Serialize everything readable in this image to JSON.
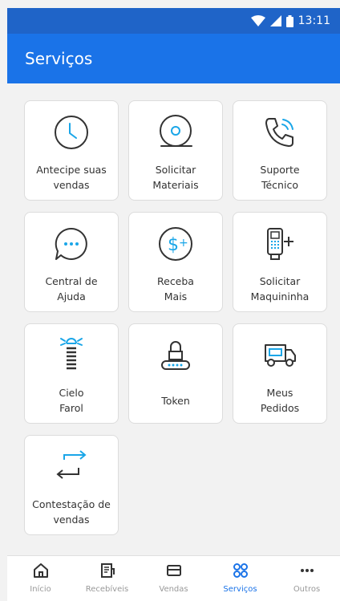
{
  "status_bar": {
    "time": "13:11",
    "icons": [
      "wifi-icon",
      "signal-icon",
      "battery-icon"
    ]
  },
  "app_bar": {
    "title": "Serviços"
  },
  "services": [
    {
      "label": "Antecipe suas\nvendas",
      "icon": "clock-icon"
    },
    {
      "label": "Solicitar\nMateriais",
      "icon": "paper-roll-icon"
    },
    {
      "label": "Suporte\nTécnico",
      "icon": "phone-ringing-icon"
    },
    {
      "label": "Central de\nAjuda",
      "icon": "chat-bubble-icon"
    },
    {
      "label": "Receba\nMais",
      "icon": "dollar-plus-icon"
    },
    {
      "label": "Solicitar\nMaquininha",
      "icon": "card-machine-plus-icon"
    },
    {
      "label": "Cielo\nFarol",
      "icon": "lighthouse-icon"
    },
    {
      "label": "Token",
      "icon": "token-lock-icon"
    },
    {
      "label": "Meus\nPedidos",
      "icon": "delivery-truck-icon"
    },
    {
      "label": "Contestação de\nvendas",
      "icon": "swap-arrows-icon"
    }
  ],
  "bottom_nav": [
    {
      "label": "Início",
      "icon": "home-icon",
      "active": false
    },
    {
      "label": "Recebíveis",
      "icon": "document-icon",
      "active": false
    },
    {
      "label": "Vendas",
      "icon": "card-icon",
      "active": false
    },
    {
      "label": "Serviços",
      "icon": "grid-icon",
      "active": true
    },
    {
      "label": "Outros",
      "icon": "more-icon",
      "active": false
    }
  ],
  "colors": {
    "primary": "#1a73e8",
    "status": "#1f64c8",
    "accent_icon": "#1aa6e8",
    "icon_dark": "#333333"
  }
}
